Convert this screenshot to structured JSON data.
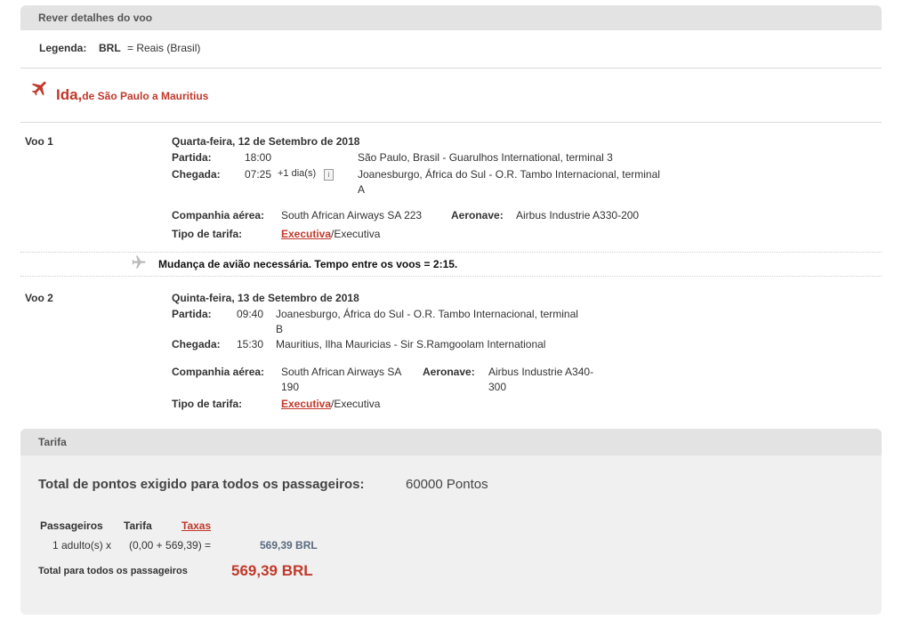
{
  "review_panel": {
    "title": "Rever detalhes do voo"
  },
  "legend": {
    "label": "Legenda:",
    "code": "BRL",
    "description": "= Reais (Brasil)"
  },
  "trip": {
    "title": "Ida,",
    "subtitle": "de São Paulo a Mauritius"
  },
  "flights": [
    {
      "label": "Voo 1",
      "date": "Quarta-feira, 12 de Setembro de 2018",
      "departure_label": "Partida:",
      "departure_time": "18:00",
      "departure_place": "São Paulo, Brasil - Guarulhos International, terminal 3",
      "arrival_label": "Chegada:",
      "arrival_time": "07:25",
      "arrival_offset": "+1 dia(s)",
      "arrival_place_line1": "Joanesburgo, África do Sul - O.R. Tambo Internacional, terminal",
      "arrival_place_line2": "A",
      "airline_label": "Companhia aérea:",
      "airline": "South African Airways SA 223",
      "aircraft_label": "Aeronave:",
      "aircraft": "Airbus Industrie A330-200",
      "fare_type_label": "Tipo de tarifa:",
      "fare_type_link": "Executiva",
      "fare_type_rest": "/Executiva"
    },
    {
      "label": "Voo 2",
      "date": "Quinta-feira, 13 de Setembro de 2018",
      "departure_label": "Partida:",
      "departure_time": "09:40",
      "departure_place_line1": "Joanesburgo, África do Sul - O.R. Tambo Internacional, terminal",
      "departure_place_line2": "B",
      "arrival_label": "Chegada:",
      "arrival_time": "15:30",
      "arrival_place": "Mauritius, Ilha Mauricias - Sir S.Ramgoolam International",
      "airline_label": "Companhia aérea:",
      "airline_line1": "South African Airways SA",
      "airline_line2": "190",
      "aircraft_label": "Aeronave:",
      "aircraft_line1": "Airbus Industrie A340-",
      "aircraft_line2": "300",
      "fare_type_label": "Tipo de tarifa:",
      "fare_type_link": "Executiva",
      "fare_type_rest": "/Executiva"
    }
  ],
  "connection": {
    "text": "Mudança de avião necessária. Tempo entre os voos = 2:15."
  },
  "fare": {
    "title": "Tarifa",
    "total_points_label": "Total de pontos exigido para todos os passageiros:",
    "total_points_value": "60000 Pontos",
    "col_passengers": "Passageiros",
    "col_fare": "Tarifa",
    "col_taxes": "Taxas",
    "row_passengers": "1 adulto(s)  x",
    "row_calc": "(0,00  +  569,39)  =",
    "row_total": "569,39 BRL",
    "grand_total_label": "Total para todos os passageiros",
    "grand_total_value": "569,39 BRL"
  },
  "colors": {
    "accent_red": "#c0392b",
    "panel_header": "#e3e3e3",
    "panel_bg": "#f0f0f0"
  },
  "icons": {
    "trip": "airplane-icon",
    "connection": "airplane-icon",
    "info": "info-icon"
  }
}
